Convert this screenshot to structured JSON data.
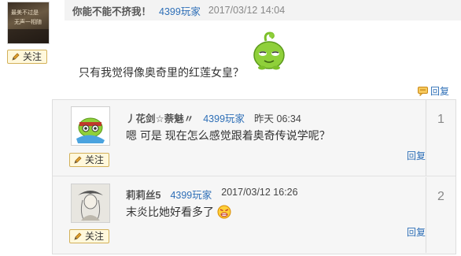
{
  "post": {
    "author": "你能不能不挤我！",
    "author_tag": "4399玩家",
    "date": "2017/03/12 14:04",
    "avatar_text_1": "最美不过是",
    "avatar_text_2": "无声一相随",
    "follow_label": "关注",
    "content": "只有我觉得像奥奇里的红莲女皇？",
    "reply_label": "回复"
  },
  "comments": [
    {
      "author": "丿花剑☆萘魅〃",
      "author_tag": "4399玩家",
      "date": "昨天 06:34",
      "content": "嗯 可是 现在怎么感觉跟着奥奇传说学呢？",
      "follow_label": "关注",
      "reply_label": "回复",
      "floor": "1"
    },
    {
      "author": "莉莉丝5",
      "author_tag": "4399玩家",
      "date": "2017/03/12 16:26",
      "content": "末炎比她好看多了",
      "follow_label": "关注",
      "reply_label": "回复",
      "floor": "2"
    }
  ],
  "icons": {
    "follow": "pencil-icon",
    "reply": "reply-bubble-icon",
    "emoji": "angry-face-icon"
  },
  "colors": {
    "link": "#2e6fb7",
    "follow_border": "#d3b15a",
    "follow_bg": "#fff8dc",
    "header_bg": "#f3f3f3",
    "comment_bg": "#f6f6f6"
  }
}
